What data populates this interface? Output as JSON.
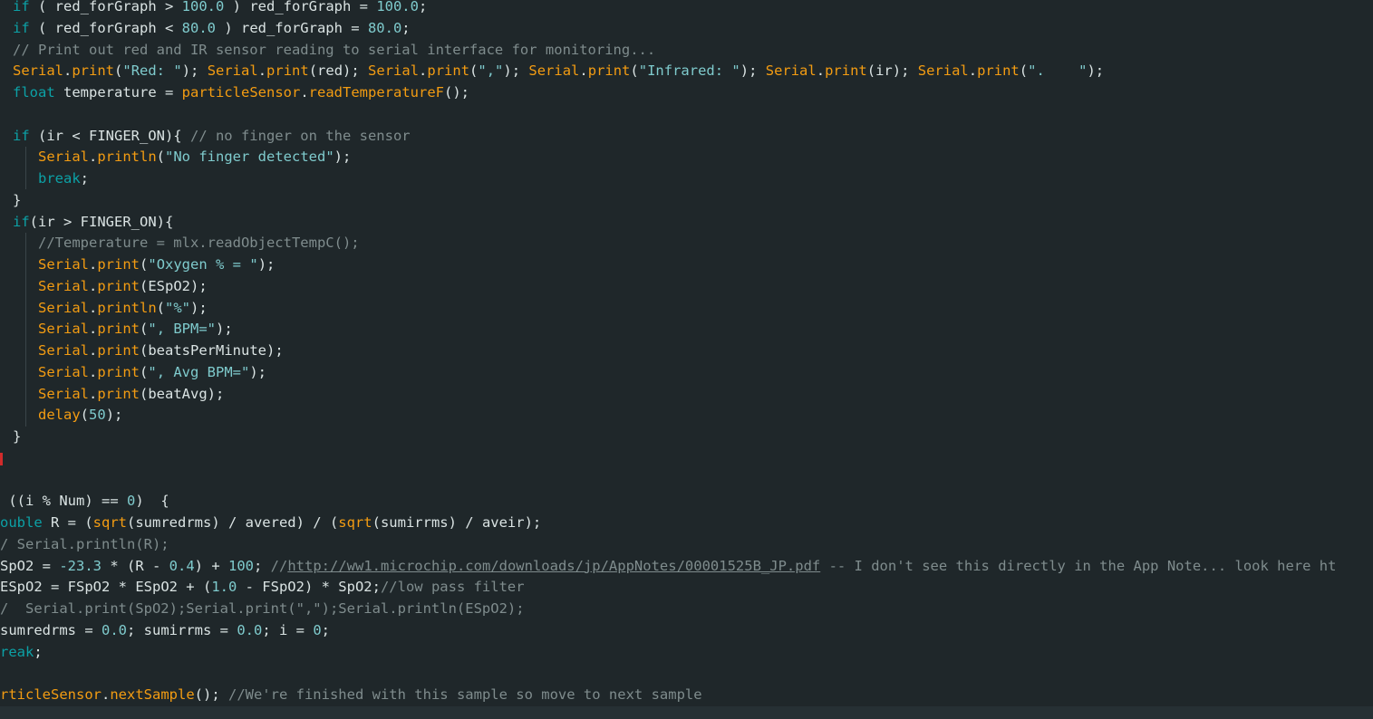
{
  "editor": {
    "lines": [
      {
        "tokens": [
          [
            "keyword",
            "if"
          ],
          [
            "punct",
            " ( "
          ],
          [
            "ident",
            "red_forGraph"
          ],
          [
            "punct",
            " > "
          ],
          [
            "number",
            "100.0"
          ],
          [
            "punct",
            " ) "
          ],
          [
            "ident",
            "red_forGraph"
          ],
          [
            "punct",
            " = "
          ],
          [
            "number",
            "100.0"
          ],
          [
            "punct",
            ";"
          ]
        ]
      },
      {
        "tokens": [
          [
            "keyword",
            "if"
          ],
          [
            "punct",
            " ( "
          ],
          [
            "ident",
            "red_forGraph"
          ],
          [
            "punct",
            " < "
          ],
          [
            "number",
            "80.0"
          ],
          [
            "punct",
            " ) "
          ],
          [
            "ident",
            "red_forGraph"
          ],
          [
            "punct",
            " = "
          ],
          [
            "number",
            "80.0"
          ],
          [
            "punct",
            ";"
          ]
        ]
      },
      {
        "tokens": [
          [
            "comment",
            "// Print out red and IR sensor reading to serial interface for monitoring..."
          ]
        ]
      },
      {
        "tokens": [
          [
            "func",
            "Serial"
          ],
          [
            "punct",
            "."
          ],
          [
            "func",
            "print"
          ],
          [
            "punct",
            "("
          ],
          [
            "string",
            "\"Red: \""
          ],
          [
            "punct",
            "); "
          ],
          [
            "func",
            "Serial"
          ],
          [
            "punct",
            "."
          ],
          [
            "func",
            "print"
          ],
          [
            "punct",
            "(red); "
          ],
          [
            "func",
            "Serial"
          ],
          [
            "punct",
            "."
          ],
          [
            "func",
            "print"
          ],
          [
            "punct",
            "("
          ],
          [
            "string",
            "\",\""
          ],
          [
            "punct",
            "); "
          ],
          [
            "func",
            "Serial"
          ],
          [
            "punct",
            "."
          ],
          [
            "func",
            "print"
          ],
          [
            "punct",
            "("
          ],
          [
            "string",
            "\"Infrared: \""
          ],
          [
            "punct",
            "); "
          ],
          [
            "func",
            "Serial"
          ],
          [
            "punct",
            "."
          ],
          [
            "func",
            "print"
          ],
          [
            "punct",
            "(ir); "
          ],
          [
            "func",
            "Serial"
          ],
          [
            "punct",
            "."
          ],
          [
            "func",
            "print"
          ],
          [
            "punct",
            "("
          ],
          [
            "string",
            "\".    \""
          ],
          [
            "punct",
            ");"
          ]
        ]
      },
      {
        "tokens": [
          [
            "keyword",
            "float"
          ],
          [
            "punct",
            " "
          ],
          [
            "ident",
            "temperature"
          ],
          [
            "punct",
            " = "
          ],
          [
            "func",
            "particleSensor"
          ],
          [
            "punct",
            "."
          ],
          [
            "func",
            "readTemperatureF"
          ],
          [
            "punct",
            "();"
          ]
        ]
      },
      {
        "tokens": []
      },
      {
        "tokens": [
          [
            "keyword",
            "if"
          ],
          [
            "punct",
            " (ir < FINGER_ON){ "
          ],
          [
            "comment",
            "// no finger on the sensor"
          ]
        ]
      },
      {
        "tokens": [
          [
            "func",
            "Serial"
          ],
          [
            "punct",
            "."
          ],
          [
            "func",
            "println"
          ],
          [
            "punct",
            "("
          ],
          [
            "string",
            "\"No finger detected\""
          ],
          [
            "punct",
            ");"
          ]
        ]
      },
      {
        "tokens": [
          [
            "keyword",
            "break"
          ],
          [
            "punct",
            ";"
          ]
        ]
      },
      {
        "tokens": [
          [
            "punct",
            "}"
          ]
        ]
      },
      {
        "tokens": [
          [
            "keyword",
            "if"
          ],
          [
            "punct",
            "(ir > FINGER_ON){"
          ]
        ]
      },
      {
        "tokens": [
          [
            "comment",
            "//Temperature = mlx.readObjectTempC();"
          ]
        ]
      },
      {
        "tokens": [
          [
            "func",
            "Serial"
          ],
          [
            "punct",
            "."
          ],
          [
            "func",
            "print"
          ],
          [
            "punct",
            "("
          ],
          [
            "string",
            "\"Oxygen % = \""
          ],
          [
            "punct",
            ");"
          ]
        ]
      },
      {
        "tokens": [
          [
            "func",
            "Serial"
          ],
          [
            "punct",
            "."
          ],
          [
            "func",
            "print"
          ],
          [
            "punct",
            "(ESpO2);"
          ]
        ]
      },
      {
        "tokens": [
          [
            "func",
            "Serial"
          ],
          [
            "punct",
            "."
          ],
          [
            "func",
            "println"
          ],
          [
            "punct",
            "("
          ],
          [
            "string",
            "\"%\""
          ],
          [
            "punct",
            ");"
          ]
        ]
      },
      {
        "tokens": [
          [
            "func",
            "Serial"
          ],
          [
            "punct",
            "."
          ],
          [
            "func",
            "print"
          ],
          [
            "punct",
            "("
          ],
          [
            "string",
            "\", BPM=\""
          ],
          [
            "punct",
            ");"
          ]
        ]
      },
      {
        "tokens": [
          [
            "func",
            "Serial"
          ],
          [
            "punct",
            "."
          ],
          [
            "func",
            "print"
          ],
          [
            "punct",
            "(beatsPerMinute);"
          ]
        ]
      },
      {
        "tokens": [
          [
            "func",
            "Serial"
          ],
          [
            "punct",
            "."
          ],
          [
            "func",
            "print"
          ],
          [
            "punct",
            "("
          ],
          [
            "string",
            "\", Avg BPM=\""
          ],
          [
            "punct",
            ");"
          ]
        ]
      },
      {
        "tokens": [
          [
            "func",
            "Serial"
          ],
          [
            "punct",
            "."
          ],
          [
            "func",
            "print"
          ],
          [
            "punct",
            "(beatAvg);"
          ]
        ]
      },
      {
        "tokens": [
          [
            "func",
            "delay"
          ],
          [
            "punct",
            "("
          ],
          [
            "number",
            "50"
          ],
          [
            "punct",
            ");"
          ]
        ]
      },
      {
        "tokens": [
          [
            "punct",
            "}"
          ]
        ]
      },
      {
        "tokens": []
      },
      {
        "tokens": []
      },
      {
        "tokens": [
          [
            "punct",
            " ((i % Num) == "
          ],
          [
            "number",
            "0"
          ],
          [
            "punct",
            ")  {"
          ]
        ]
      },
      {
        "tokens": [
          [
            "keyword",
            "ouble"
          ],
          [
            "punct",
            " R = ("
          ],
          [
            "func",
            "sqrt"
          ],
          [
            "punct",
            "(sumredrms) / avered) / ("
          ],
          [
            "func",
            "sqrt"
          ],
          [
            "punct",
            "(sumirrms) / aveir);"
          ]
        ]
      },
      {
        "tokens": [
          [
            "comment",
            "/ Serial.println(R);"
          ]
        ]
      },
      {
        "tokens": [
          [
            "ident",
            "SpO2"
          ],
          [
            "punct",
            " = "
          ],
          [
            "number",
            "-23.3"
          ],
          [
            "punct",
            " * (R - "
          ],
          [
            "number",
            "0.4"
          ],
          [
            "punct",
            ") + "
          ],
          [
            "number",
            "100"
          ],
          [
            "punct",
            "; "
          ],
          [
            "comment",
            "//"
          ],
          [
            "link",
            "http://ww1.microchip.com/downloads/jp/AppNotes/00001525B_JP.pdf"
          ],
          [
            "comment",
            " -- I don't see this directly in the App Note... look here ht"
          ]
        ]
      },
      {
        "tokens": [
          [
            "ident",
            "ESpO2"
          ],
          [
            "punct",
            " = FSpO2 * ESpO2 + ("
          ],
          [
            "number",
            "1.0"
          ],
          [
            "punct",
            " - FSpO2) * SpO2;"
          ],
          [
            "comment",
            "//low pass filter"
          ]
        ]
      },
      {
        "tokens": [
          [
            "comment",
            "/  Serial.print(SpO2);Serial.print(\",\");Serial.println(ESpO2);"
          ]
        ]
      },
      {
        "tokens": [
          [
            "ident",
            "sumredrms"
          ],
          [
            "punct",
            " = "
          ],
          [
            "number",
            "0.0"
          ],
          [
            "punct",
            "; sumirrms = "
          ],
          [
            "number",
            "0.0"
          ],
          [
            "punct",
            "; i = "
          ],
          [
            "number",
            "0"
          ],
          [
            "punct",
            ";"
          ]
        ]
      },
      {
        "tokens": [
          [
            "keyword",
            "reak"
          ],
          [
            "punct",
            ";"
          ]
        ]
      },
      {
        "tokens": []
      },
      {
        "tokens": [
          [
            "func",
            "rticleSensor"
          ],
          [
            "punct",
            "."
          ],
          [
            "func",
            "nextSample"
          ],
          [
            "punct",
            "(); "
          ],
          [
            "comment",
            "//We're finished with this sample so move to next sample"
          ]
        ]
      }
    ]
  }
}
